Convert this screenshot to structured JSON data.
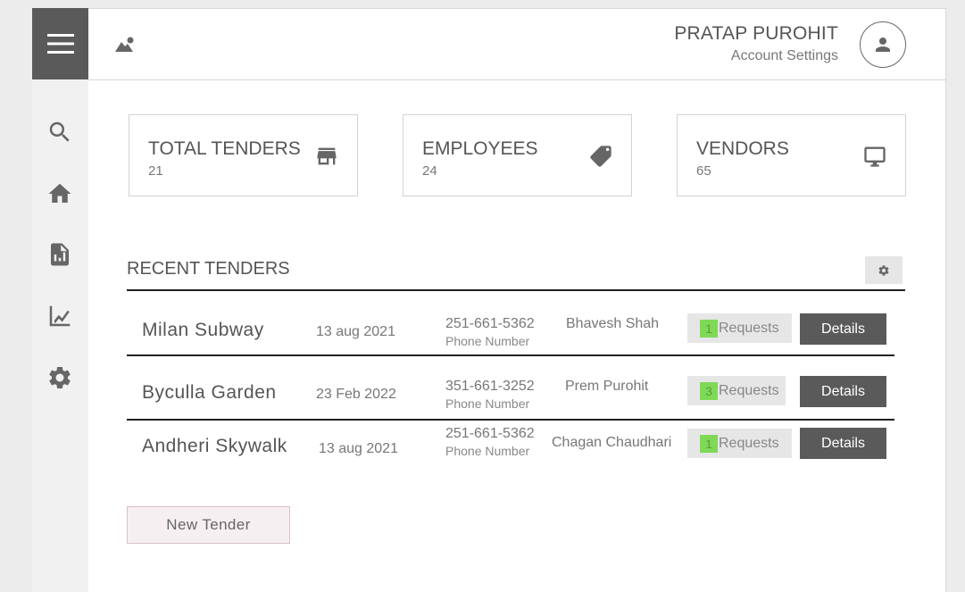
{
  "header": {
    "user_name": "PRATAP PUROHIT",
    "account_settings": "Account Settings"
  },
  "sidebar": {
    "items": [
      {
        "icon": "search-icon"
      },
      {
        "icon": "home-icon"
      },
      {
        "icon": "report-icon"
      },
      {
        "icon": "chart-icon"
      },
      {
        "icon": "gear-icon"
      }
    ]
  },
  "stats": [
    {
      "title": "TOTAL TENDERS",
      "value": "21",
      "icon": "store-icon"
    },
    {
      "title": "EMPLOYEES",
      "value": "24",
      "icon": "tag-icon"
    },
    {
      "title": "VENDORS",
      "value": "65",
      "icon": "monitor-icon"
    }
  ],
  "recent": {
    "title": "RECENT TENDERS",
    "requests_label": "Requests",
    "details_label": "Details",
    "phone_label": "Phone Number",
    "rows": [
      {
        "name": "Milan Subway",
        "date": "13 aug 2021",
        "phone": "251-661-5362",
        "contact": "Bhavesh Shah",
        "requests": "1"
      },
      {
        "name": "Byculla Garden",
        "date": "23 Feb 2022",
        "phone": "351-661-3252",
        "contact": "Prem Purohit",
        "requests": "3"
      },
      {
        "name": "Andheri Skywalk",
        "date": "13 aug 2021",
        "phone": "251-661-5362",
        "contact": "Chagan Chaudhari",
        "requests": "1"
      }
    ]
  },
  "new_tender_label": "New Tender",
  "colors": {
    "accent_dark": "#5a5a5a",
    "request_badge": "#7ed957"
  }
}
